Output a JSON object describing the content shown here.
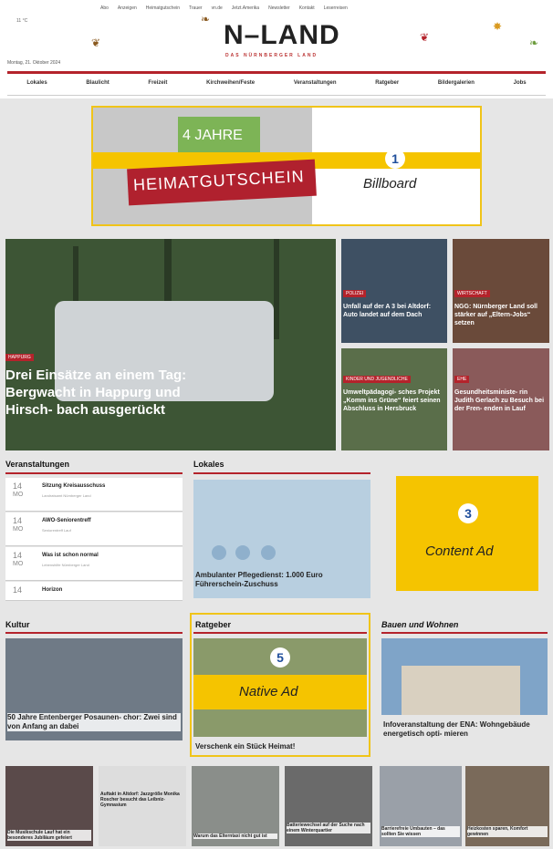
{
  "header": {
    "toplinks": [
      "Abo",
      "Anzeigen",
      "Heimatgutschein",
      "Trauer",
      "vn.de",
      "Jetzt.Amerika",
      "Newsletter",
      "Kontakt",
      "Leserreisen"
    ],
    "logo": "N–LAND",
    "tagline": "DAS NÜRNBERGER LAND",
    "weather": "11 °C",
    "date": "Montag, 21. Oktober 2024"
  },
  "nav": [
    "Lokales",
    "Blaulicht",
    "Freizeit",
    "Kirchweihen/Feste",
    "Veranstaltungen",
    "Ratgeber",
    "Bildergalerien",
    "Jobs"
  ],
  "billboard": {
    "jahre": "4 JAHRE",
    "banner": "HEIMATGUTSCHEIN",
    "badge": "1",
    "label": "Billboard"
  },
  "hero": {
    "tag": "HAPPURG",
    "title": "Drei Einsätze an einem Tag: Bergwacht in Happurg und Hirsch- bach ausgerückt"
  },
  "tiles": [
    {
      "tag": "POLIZEI",
      "title": "Unfall auf der A 3 bei Altdorf: Auto landet auf dem Dach"
    },
    {
      "tag": "WIRTSCHAFT",
      "title": "NGG: Nürnberger Land soll stärker auf „Eltern-Jobs“ setzen"
    },
    {
      "tag": "KINDER UND JUGENDLICHE",
      "title": "Umweltpädagogi- sches Projekt „Komm ins Grüne“ feiert seinen Abschluss in Hersbruck"
    },
    {
      "tag": "EHE",
      "title": "Gesundheitsministe- rin Judith Gerlach zu Besuch bei der Fren- enden in Lauf"
    }
  ],
  "veranstaltungen": {
    "title": "Veranstaltungen",
    "events": [
      {
        "day": "14",
        "mo": "MO",
        "title": "Sitzung Kreisausschuss",
        "sub": "Landratsamt Nürnberger Land"
      },
      {
        "day": "14",
        "mo": "MO",
        "title": "AWO-Seniorentreff",
        "sub": "Seniorentreff Lauf"
      },
      {
        "day": "14",
        "mo": "MO",
        "title": "Was ist schon normal",
        "sub": "Lebenshilfe Nürnberger Land"
      },
      {
        "day": "14",
        "mo": "",
        "title": "Horizon",
        "sub": ""
      }
    ]
  },
  "lokales": {
    "title": "Lokales",
    "card_title": "Ambulanter Pflegedienst: 1.000 Euro Führerschein-Zuschuss"
  },
  "content_ad": {
    "badge": "3",
    "label": "Content Ad"
  },
  "kultur": {
    "title": "Kultur",
    "card_title": "50 Jahre Entenberger Posaunen- chor: Zwei sind von Anfang an dabei"
  },
  "ratgeber": {
    "title": "Ratgeber",
    "card_title": "Verschenk ein Stück Heimat!",
    "badge": "5",
    "label": "Native Ad"
  },
  "bauen": {
    "title": "Bauen und Wohnen",
    "card_title": "Infoveranstaltung der ENA: Wohngebäude energetisch opti- mieren"
  },
  "thumbs": [
    "Die Musikschule Lauf hat ein besonderes Jubiläum gefeiert",
    "Auftakt in Altdorf: Jazzgröße Monika Roscher besucht das Leibniz-Gymnasium",
    "Warum das Elterntaxi nicht gut ist",
    "Batteriewechsel auf der Suche nach einem Winterquartier",
    "Barrierefreie Umbauten – das sollten Sie wissen",
    "Heizkosten sparen, Komfort gewinnen"
  ],
  "colors": {
    "accent": "#b4232b",
    "highlight": "#f5c400",
    "badge_text": "#1f4e9b"
  }
}
